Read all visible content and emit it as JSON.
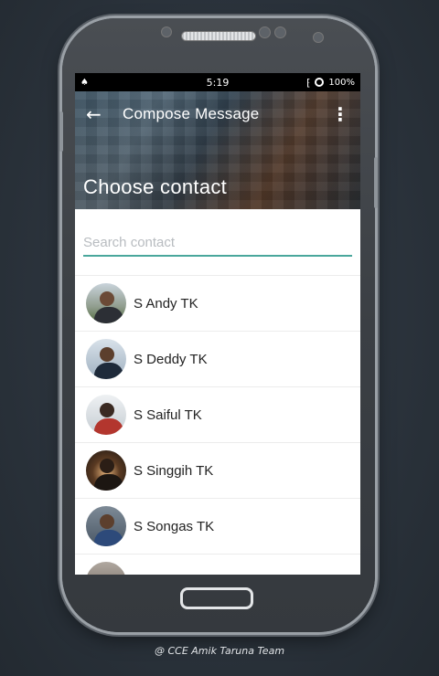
{
  "status_bar": {
    "time": "5:19",
    "battery": "100%",
    "left_icon": "android-notification-icon",
    "signal_icon": "signal-icon",
    "battery_icon": "battery-icon"
  },
  "toolbar": {
    "title": "Compose Message",
    "back_icon": "back-arrow-icon",
    "menu_icon": "overflow-menu-icon"
  },
  "header": {
    "title": "Choose contact"
  },
  "search": {
    "value": "",
    "placeholder": "Search contact"
  },
  "contacts": [
    {
      "name": "S Andy TK"
    },
    {
      "name": "S Deddy TK"
    },
    {
      "name": "S Saiful TK"
    },
    {
      "name": "S Singgih TK"
    },
    {
      "name": "S Songas TK"
    }
  ],
  "footer": {
    "credit": "@ CCE Amik Taruna Team"
  },
  "colors": {
    "accent": "#4aa79c",
    "statusbar": "#000000"
  }
}
